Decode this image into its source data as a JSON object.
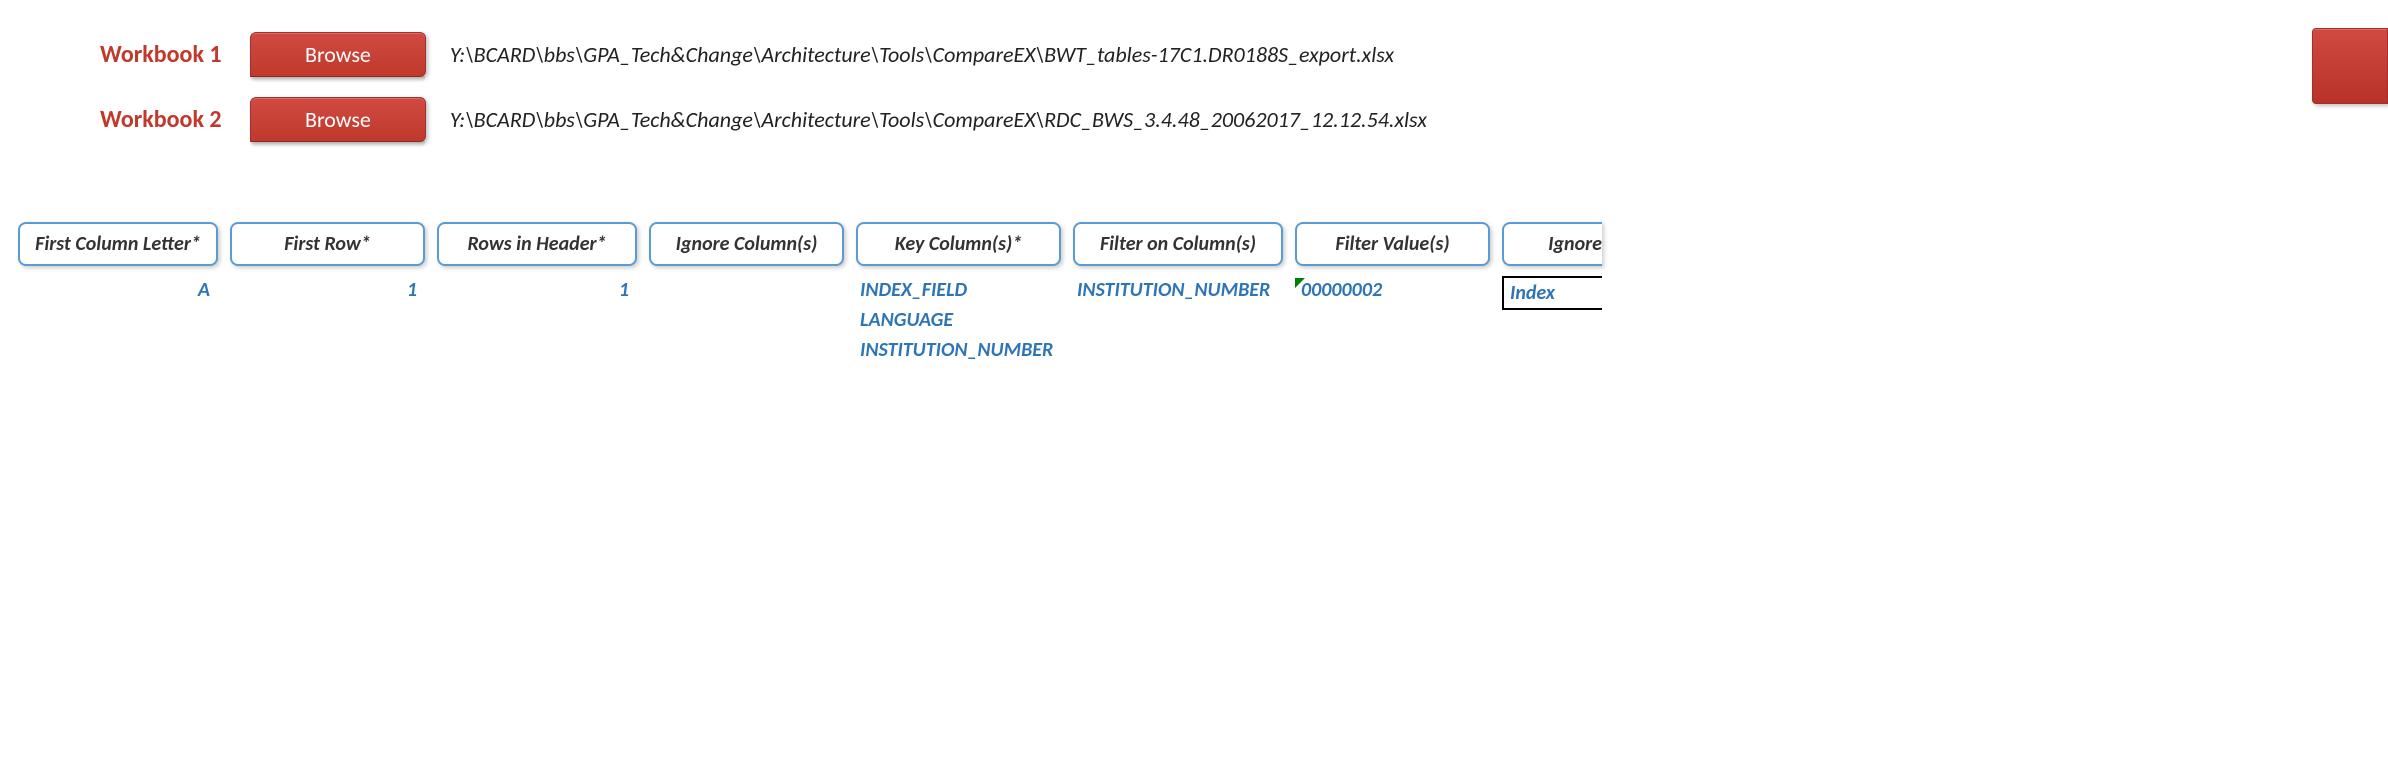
{
  "workbooks": [
    {
      "label": "Workbook 1",
      "browse_label": "Browse",
      "path": "Y:\\BCARD\\bbs\\GPA_Tech&Change\\Architecture\\Tools\\CompareEX\\BWT_tables-17C1.DR0188S_export.xlsx"
    },
    {
      "label": "Workbook 2",
      "browse_label": "Browse",
      "path": "Y:\\BCARD\\bbs\\GPA_Tech&Change\\Architecture\\Tools\\CompareEX\\RDC_BWS_3.4.48_20062017_12.12.54.xlsx"
    }
  ],
  "columns": {
    "first_column_letter": {
      "label": "First Column Letter*",
      "value": "A"
    },
    "first_row": {
      "label": "First Row*",
      "value": "1"
    },
    "rows_in_header": {
      "label": "Rows in Header*",
      "value": "1"
    },
    "ignore_columns": {
      "label": "Ignore Column(s)",
      "value": ""
    },
    "key_columns": {
      "label": "Key Column(s)*",
      "values": [
        "INDEX_FIELD",
        "LANGUAGE",
        "INSTITUTION_NUMBER"
      ]
    },
    "filter_on_columns": {
      "label": "Filter on Column(s)",
      "values": [
        "INSTITUTION_NUMBER"
      ]
    },
    "filter_values": {
      "label": "Filter Value(s)",
      "value": "00000002"
    },
    "ignore_partial": {
      "label": "Ignore",
      "value": "Index"
    }
  }
}
